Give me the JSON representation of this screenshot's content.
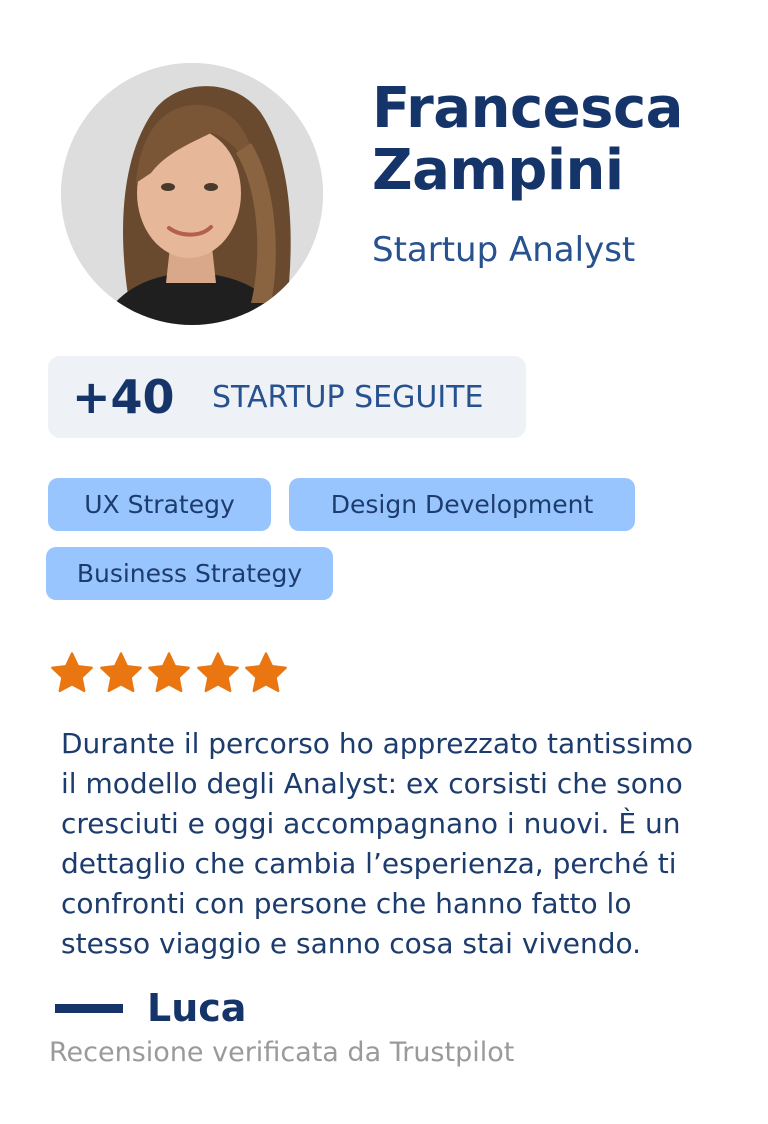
{
  "profile": {
    "name_first": "Francesca",
    "name_last": "Zampini",
    "role": "Startup Analyst"
  },
  "stat": {
    "value": "+40",
    "label": "STARTUP SEGUITE"
  },
  "tags": [
    "UX Strategy",
    "Design Development",
    "Business Strategy"
  ],
  "rating": {
    "stars": 5,
    "max": 5,
    "star_color": "#ea7612"
  },
  "review": {
    "lines": [
      "Durante il percorso ho apprezzato tantissimo",
      "il modello degli Analyst: ex corsisti che sono",
      "cresciuti e oggi accompagnano i nuovi. È un",
      "dettaglio che cambia l’esperienza, perché ti",
      "confronti con persone che hanno fatto lo",
      "stesso viaggio e sanno cosa stai vivendo."
    ],
    "author": "Luca",
    "verified_text": "Recensione verificata da Trustpilot"
  },
  "colors": {
    "primary": "#15356a",
    "accent_text": "#27528f",
    "tag_bg": "#99c5ff",
    "stat_bg": "#eef1f5",
    "muted": "#9a9a9a"
  },
  "icons": {
    "avatar": "person-photo",
    "rating": "star-icon"
  }
}
